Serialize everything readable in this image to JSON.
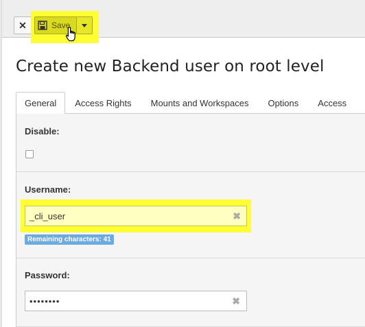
{
  "toolbar": {
    "close_icon": "close-icon",
    "save_icon": "floppy-disk-icon",
    "save_label": "Save",
    "dropdown_icon": "caret-down-icon",
    "highlight_color": "#ffff33"
  },
  "page": {
    "title": "Create new Backend user on root level"
  },
  "tabs": [
    {
      "label": "General",
      "active": true
    },
    {
      "label": "Access Rights",
      "active": false
    },
    {
      "label": "Mounts and Workspaces",
      "active": false
    },
    {
      "label": "Options",
      "active": false
    },
    {
      "label": "Access",
      "active": false
    }
  ],
  "form": {
    "disable": {
      "label": "Disable:",
      "checked": false
    },
    "username": {
      "label": "Username:",
      "value": "_cli_user",
      "remaining": "Remaining characters: 41"
    },
    "password": {
      "label": "Password:",
      "value": "••••••••"
    },
    "clear_icon": "✖"
  },
  "colors": {
    "accent_badge": "#6daae0",
    "highlight": "#ffff33"
  }
}
